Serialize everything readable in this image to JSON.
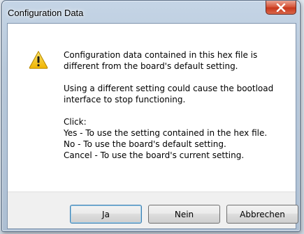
{
  "window": {
    "title": "Configuration Data",
    "close_icon": "close-icon"
  },
  "dialog": {
    "icon": "warning-icon",
    "paragraph1": [
      "Configuration data contained in this hex file is",
      "different from the board's default setting."
    ],
    "paragraph2": [
      "Using a different setting could cause the bootload",
      "interface to stop functioning."
    ],
    "paragraph3": [
      "Click:",
      "Yes - To use the setting contained in the hex file.",
      "No - To use the board's default setting.",
      "Cancel - To use the board's current setting."
    ]
  },
  "buttons": {
    "yes_label": "Ja",
    "no_label": "Nein",
    "cancel_label": "Abbrechen"
  },
  "colors": {
    "close_button": "#c7381d",
    "warning_yellow": "#f3c311",
    "default_button_border": "#3c7fb1"
  }
}
